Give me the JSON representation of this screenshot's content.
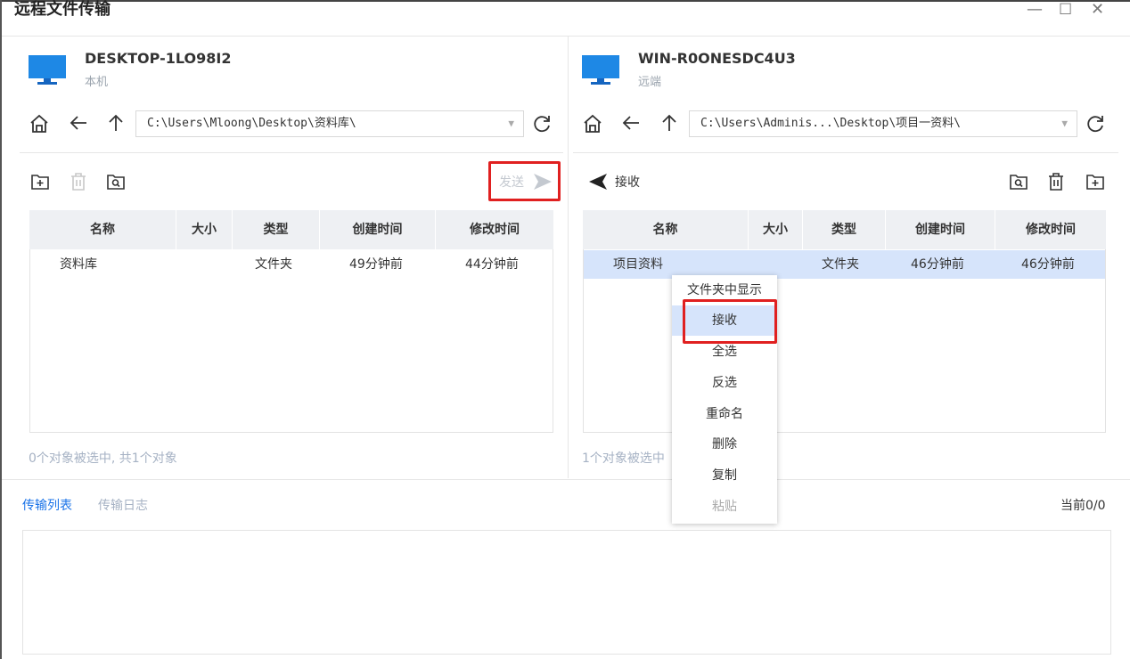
{
  "window": {
    "title": "远程文件传输",
    "controls": [
      "—",
      "☐",
      "✕"
    ]
  },
  "local": {
    "name": "DESKTOP-1LO98I2",
    "sub": "本机",
    "path": "C:\\Users\\Mloong\\Desktop\\资料库\\",
    "send_label": "发送",
    "columns": [
      "名称",
      "大小",
      "类型",
      "创建时间",
      "修改时间"
    ],
    "rows": [
      {
        "name": "资料库",
        "size": "",
        "type": "文件夹",
        "created": "49分钟前",
        "modified": "44分钟前"
      }
    ],
    "status": "0个对象被选中, 共1个对象"
  },
  "remote": {
    "name": "WIN-R0ONESDC4U3",
    "sub": "远端",
    "path": "C:\\Users\\Adminis...\\Desktop\\项目一资料\\",
    "receive_label": "接收",
    "columns": [
      "名称",
      "大小",
      "类型",
      "创建时间",
      "修改时间"
    ],
    "rows": [
      {
        "name": "项目资料",
        "size": "",
        "type": "文件夹",
        "created": "46分钟前",
        "modified": "46分钟前"
      }
    ],
    "status": "1个对象被选中"
  },
  "context_menu": {
    "items": [
      "文件夹中显示",
      "接收",
      "全选",
      "反选",
      "重命名",
      "删除",
      "复制",
      "粘贴"
    ]
  },
  "transfer": {
    "tab_list": "传输列表",
    "tab_log": "传输日志",
    "count": "当前0/0"
  },
  "colors": {
    "accent": "#1a73e8",
    "selected_row": "#d6e4fb",
    "highlight_box": "#e02020",
    "monitor": "#1e88e5"
  }
}
